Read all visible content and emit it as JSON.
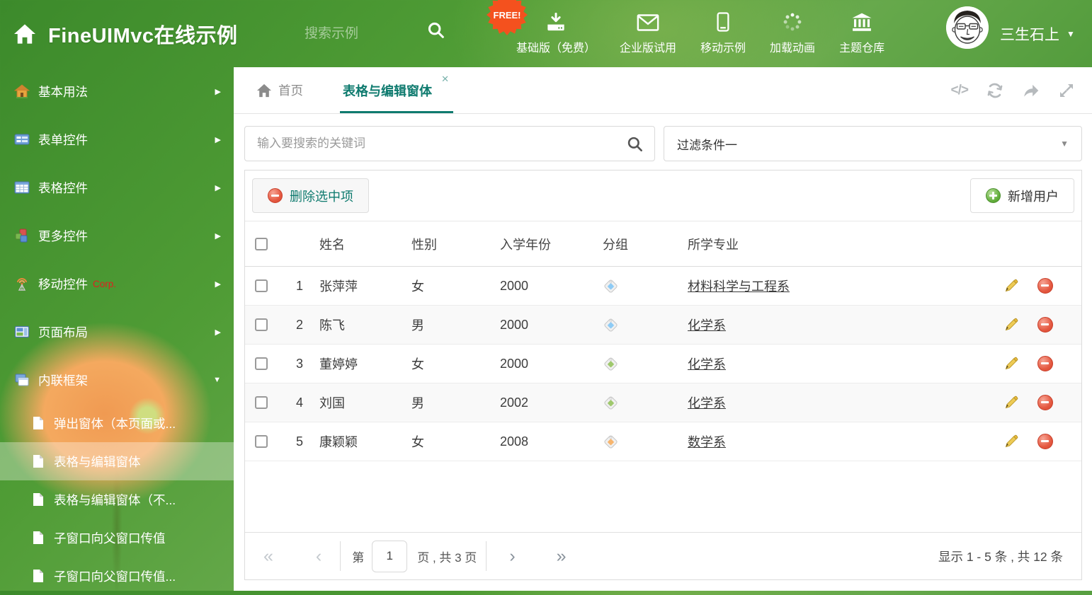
{
  "colors": {
    "accent": "#0f7b6f",
    "header-green": "#47942f",
    "corp-red": "#e01f1f",
    "free-badge": "#f4511e",
    "tag-blue": "#8ecbf5",
    "tag-green": "#9fc86d",
    "tag-orange": "#f7b56e"
  },
  "icons": {
    "close": "✕",
    "caret_down": "▼",
    "arrow_right": "▶",
    "code": "</>",
    "pg_first": "«",
    "pg_prev": "‹",
    "pg_next": "›",
    "pg_last": "»"
  },
  "header": {
    "title": "FineUIMvc在线示例",
    "search_placeholder": "搜索示例",
    "free_badge": "FREE!",
    "nav_items": [
      {
        "label": "基础版（免费）",
        "icon": "download-icon"
      },
      {
        "label": "企业版试用",
        "icon": "envelope-icon"
      },
      {
        "label": "移动示例",
        "icon": "phone-icon"
      },
      {
        "label": "加载动画",
        "icon": "spinner-icon"
      },
      {
        "label": "主题仓库",
        "icon": "bank-icon"
      }
    ],
    "username": "三生石上"
  },
  "sidebar": {
    "items": [
      {
        "label": "基本用法",
        "icon": "house-icon"
      },
      {
        "label": "表单控件",
        "icon": "form-icon"
      },
      {
        "label": "表格控件",
        "icon": "table-icon"
      },
      {
        "label": "更多控件",
        "icon": "cubes-icon"
      },
      {
        "label": "移动控件",
        "badge": "Corp.",
        "icon": "antenna-icon"
      },
      {
        "label": "页面布局",
        "icon": "layout-icon"
      },
      {
        "label": "内联框架",
        "icon": "frames-icon",
        "expanded": true
      }
    ],
    "subitems": [
      {
        "label": "弹出窗体（本页面或..."
      },
      {
        "label": "表格与编辑窗体",
        "active": true
      },
      {
        "label": "表格与编辑窗体（不..."
      },
      {
        "label": "子窗口向父窗口传值"
      },
      {
        "label": "子窗口向父窗口传值..."
      }
    ]
  },
  "tabs": [
    {
      "label": "首页",
      "icon": "home-icon"
    },
    {
      "label": "表格与编辑窗体",
      "active": true,
      "closable": true
    }
  ],
  "filters": {
    "search_placeholder": "输入要搜索的关键词",
    "filter_value": "过滤条件一"
  },
  "toolbar": {
    "delete_label": "删除选中项",
    "add_label": "新增用户"
  },
  "table": {
    "columns": [
      "姓名",
      "性别",
      "入学年份",
      "分组",
      "所学专业"
    ],
    "rows": [
      {
        "index": "1",
        "name": "张萍萍",
        "gender": "女",
        "year": "2000",
        "tag_color": "#8ecbf5",
        "major": "材料科学与工程系"
      },
      {
        "index": "2",
        "name": "陈飞",
        "gender": "男",
        "year": "2000",
        "tag_color": "#8ecbf5",
        "major": "化学系"
      },
      {
        "index": "3",
        "name": "董婷婷",
        "gender": "女",
        "year": "2000",
        "tag_color": "#9fc86d",
        "major": "化学系"
      },
      {
        "index": "4",
        "name": "刘国",
        "gender": "男",
        "year": "2002",
        "tag_color": "#9fc86d",
        "major": "化学系"
      },
      {
        "index": "5",
        "name": "康颖颖",
        "gender": "女",
        "year": "2008",
        "tag_color": "#f7b56e",
        "major": "数学系"
      }
    ]
  },
  "pagination": {
    "page_prefix": "第",
    "page_value": "1",
    "page_suffix": "页 , 共 3 页",
    "summary": "显示 1 - 5 条 , 共 12 条"
  }
}
